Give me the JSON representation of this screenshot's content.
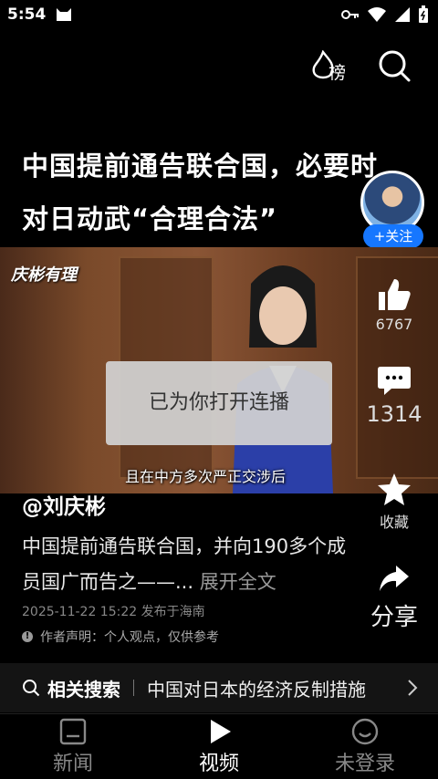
{
  "status_bar": {
    "time": "5:54"
  },
  "top_actions": {
    "trending_label": "榜"
  },
  "video": {
    "title": "中国提前通告联合国，必要时对日动武“合理合法”",
    "logo_text": "庆彬有理",
    "subtitle": "且在中方多次严正交涉后"
  },
  "follow": {
    "label": "+关注"
  },
  "toast": {
    "message": "已为你打开连播"
  },
  "actions": {
    "likes": "6767",
    "comments": "1314",
    "favorite_label": "收藏",
    "share_label": "分享"
  },
  "post": {
    "author": "@刘庆彬",
    "description": "中国提前通告联合国，并向190多个成员国广而告之——...",
    "expand_label": " 展开全文",
    "publish_meta": "2025-11-22 15:22 发布于海南",
    "disclaimer": "作者声明：个人观点，仅供参考"
  },
  "related_search": {
    "label": "相关搜索",
    "query": "中国对日本的经济反制措施"
  },
  "bottom_nav": {
    "items": [
      {
        "label": "新闻"
      },
      {
        "label": "视频"
      },
      {
        "label": "未登录"
      }
    ]
  },
  "colors": {
    "accent": "#1677ff",
    "background": "#000000"
  }
}
